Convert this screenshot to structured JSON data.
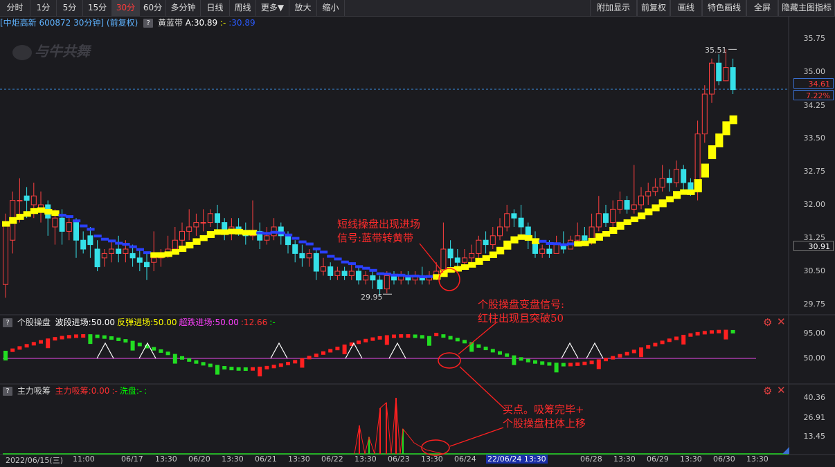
{
  "toolbar": {
    "left": [
      "分时",
      "1分",
      "5分",
      "15分",
      "30分",
      "60分",
      "多分钟",
      "日线",
      "周线",
      "更多▼",
      "放大",
      "缩小"
    ],
    "active_index": 4,
    "right": [
      "附加显示",
      "前复权",
      "画线",
      "特色画线",
      "全屏",
      "隐藏主图指标"
    ]
  },
  "info": {
    "stock": "[中炬高新 600872 30分钟]",
    "adj": "(前复权)",
    "indicator": "黄蓝带",
    "a_value": "A:30.89",
    "sep": ":-",
    "b_value": ":30.89"
  },
  "watermark": "与牛共舞",
  "main_axis": {
    "labels": [
      "35.75",
      "35.00",
      "34.25",
      "33.50",
      "32.75",
      "32.00",
      "31.25",
      "30.50",
      "29.75"
    ],
    "current_price": "34.61",
    "current_pct": "7.22%",
    "cross_price": "30.91",
    "high_label": "35.51",
    "low_label": "29.95"
  },
  "sub1": {
    "title": "个股操盘",
    "items": [
      {
        "text": "波段进场:50.00",
        "color": "#ffffff"
      },
      {
        "text": "反弹进场:50.00",
        "color": "#ffff00"
      },
      {
        "text": "超跌进场:50.00",
        "color": "#ff40ff"
      },
      {
        "text": ":12.66",
        "color": "#ff3030"
      },
      {
        "text": ":-",
        "color": "#00ff00"
      }
    ],
    "axis": [
      "95.00",
      "50.00"
    ]
  },
  "sub2": {
    "title": "主力吸筹",
    "items": [
      {
        "text": "主力吸筹:0.00",
        "color": "#ff3030"
      },
      {
        "text": ":-",
        "color": "#ff3030"
      },
      {
        "text": "洗盘:-",
        "color": "#00ff00"
      },
      {
        "text": ":",
        "color": "#00ff00"
      }
    ],
    "axis": [
      "40.36",
      "26.91",
      "13.45"
    ]
  },
  "annotations": {
    "a1_line1": "短线操盘出现进场",
    "a1_line2": "信号:蓝带转黄带",
    "a2_line1": "个股操盘变盘信号:",
    "a2_line2": "红柱出现且突破50",
    "a3_line1": "买点。吸筹完毕+",
    "a3_line2": "个股操盘柱体上移"
  },
  "xaxis": [
    {
      "text": "2022/06/15(三)",
      "x": 8
    },
    {
      "text": "11:00",
      "x": 105
    },
    {
      "text": "06/17",
      "x": 175
    },
    {
      "text": "13:30",
      "x": 224
    },
    {
      "text": "06/20",
      "x": 272
    },
    {
      "text": "13:30",
      "x": 320
    },
    {
      "text": "06/21",
      "x": 368
    },
    {
      "text": "13:30",
      "x": 416
    },
    {
      "text": "06/22",
      "x": 464
    },
    {
      "text": "13:30",
      "x": 512
    },
    {
      "text": "06/23",
      "x": 560
    },
    {
      "text": "13:30",
      "x": 608
    },
    {
      "text": "06/24",
      "x": 656
    },
    {
      "text": "22/06/24 13:30",
      "x": 702,
      "highlight": true
    },
    {
      "text": "06/28",
      "x": 838
    },
    {
      "text": "13:30",
      "x": 886
    },
    {
      "text": "06/29",
      "x": 934
    },
    {
      "text": "13:30",
      "x": 982
    },
    {
      "text": "06/30",
      "x": 1030
    },
    {
      "text": "13:30",
      "x": 1078
    }
  ],
  "chart_data": {
    "type": "candlestick",
    "interval": "30分钟",
    "ylim": [
      29.5,
      36.1
    ],
    "candles": [
      [
        30.2,
        31.6,
        31.8,
        29.9
      ],
      [
        31.2,
        32.1,
        32.3,
        30.9
      ],
      [
        32.1,
        32.1,
        32.6,
        31.6
      ],
      [
        32.2,
        32.1,
        32.4,
        31.7
      ],
      [
        32.0,
        32.2,
        32.5,
        31.7
      ],
      [
        31.9,
        32.0,
        32.3,
        31.6
      ],
      [
        32.0,
        31.7,
        32.1,
        31.3
      ],
      [
        31.5,
        31.7,
        31.9,
        31.1
      ],
      [
        31.7,
        31.4,
        31.9,
        31.1
      ],
      [
        31.4,
        31.6,
        31.7,
        31.2
      ],
      [
        31.6,
        31.2,
        31.7,
        30.8
      ],
      [
        31.2,
        31.0,
        31.4,
        30.9
      ],
      [
        31.3,
        31.1,
        31.5,
        30.8
      ],
      [
        31.0,
        30.6,
        31.2,
        30.5
      ],
      [
        30.8,
        30.9,
        31.0,
        30.6
      ],
      [
        30.9,
        31.0,
        31.2,
        30.7
      ],
      [
        31.0,
        30.9,
        31.3,
        30.7
      ],
      [
        30.9,
        31.0,
        31.2,
        30.7
      ],
      [
        30.9,
        30.8,
        31.1,
        30.6
      ],
      [
        30.8,
        30.7,
        31.0,
        30.5
      ],
      [
        30.7,
        30.6,
        30.9,
        30.3
      ],
      [
        30.7,
        30.8,
        31.4,
        30.5
      ],
      [
        30.8,
        30.9,
        31.0,
        30.6
      ],
      [
        30.9,
        31.0,
        31.3,
        30.8
      ],
      [
        31.0,
        31.2,
        31.5,
        30.9
      ],
      [
        31.2,
        31.4,
        31.6,
        31.0
      ],
      [
        31.4,
        31.5,
        31.9,
        31.2
      ],
      [
        31.5,
        31.6,
        31.8,
        31.3
      ],
      [
        31.6,
        31.6,
        31.9,
        31.4
      ],
      [
        31.6,
        31.8,
        31.9,
        31.5
      ],
      [
        31.8,
        31.6,
        32.0,
        31.4
      ],
      [
        31.6,
        31.4,
        31.7,
        31.2
      ],
      [
        31.4,
        31.5,
        31.7,
        31.2
      ],
      [
        31.5,
        31.4,
        31.7,
        31.3
      ],
      [
        31.4,
        31.3,
        31.6,
        31.1
      ],
      [
        31.3,
        31.4,
        32.1,
        31.2
      ],
      [
        31.4,
        31.2,
        31.6,
        31.0
      ],
      [
        31.2,
        31.3,
        31.5,
        31.1
      ],
      [
        31.3,
        31.5,
        31.7,
        31.2
      ],
      [
        31.5,
        31.3,
        31.6,
        31.1
      ],
      [
        31.3,
        31.1,
        31.4,
        30.9
      ],
      [
        31.1,
        30.9,
        31.2,
        30.7
      ],
      [
        30.9,
        30.8,
        31.1,
        30.6
      ],
      [
        30.8,
        30.9,
        31.0,
        30.6
      ],
      [
        30.9,
        30.5,
        31.0,
        30.3
      ],
      [
        30.5,
        30.6,
        30.8,
        30.4
      ],
      [
        30.6,
        30.4,
        30.7,
        30.3
      ],
      [
        30.4,
        30.5,
        30.6,
        30.3
      ],
      [
        30.5,
        30.4,
        30.6,
        30.3
      ],
      [
        30.4,
        30.5,
        30.7,
        30.3
      ],
      [
        30.5,
        30.3,
        30.6,
        30.2
      ],
      [
        30.3,
        30.4,
        30.5,
        30.2
      ],
      [
        30.4,
        30.3,
        30.5,
        30.1
      ],
      [
        30.3,
        30.1,
        30.4,
        29.95
      ],
      [
        30.1,
        30.4,
        30.5,
        30.0
      ],
      [
        30.4,
        30.3,
        30.5,
        30.2
      ],
      [
        30.3,
        30.4,
        30.5,
        30.2
      ],
      [
        30.4,
        30.3,
        30.5,
        30.2
      ],
      [
        30.3,
        30.4,
        30.5,
        30.2
      ],
      [
        30.4,
        30.3,
        30.6,
        30.2
      ],
      [
        30.3,
        30.4,
        30.5,
        30.2
      ],
      [
        30.4,
        30.5,
        30.7,
        30.3
      ],
      [
        30.5,
        31.0,
        31.6,
        30.4
      ],
      [
        31.0,
        30.8,
        31.2,
        30.6
      ],
      [
        30.8,
        30.7,
        31.0,
        30.6
      ],
      [
        30.7,
        30.8,
        31.0,
        30.6
      ],
      [
        30.8,
        30.9,
        31.1,
        30.7
      ],
      [
        30.9,
        31.2,
        31.3,
        30.8
      ],
      [
        31.2,
        31.1,
        31.4,
        30.9
      ],
      [
        31.1,
        31.3,
        31.5,
        31.0
      ],
      [
        31.3,
        31.5,
        31.7,
        31.2
      ],
      [
        31.5,
        31.8,
        32.0,
        31.4
      ],
      [
        31.8,
        31.7,
        31.9,
        31.5
      ],
      [
        31.7,
        31.5,
        32.0,
        31.3
      ],
      [
        31.5,
        31.2,
        31.6,
        31.0
      ],
      [
        31.2,
        30.9,
        31.4,
        30.8
      ],
      [
        30.9,
        31.0,
        31.1,
        30.8
      ],
      [
        31.0,
        30.9,
        31.2,
        30.8
      ],
      [
        30.9,
        31.1,
        31.3,
        30.9
      ],
      [
        31.1,
        31.0,
        31.4,
        30.9
      ],
      [
        31.0,
        31.2,
        31.3,
        31.0
      ],
      [
        31.2,
        31.3,
        31.6,
        31.1
      ],
      [
        31.3,
        31.2,
        31.5,
        31.1
      ],
      [
        31.2,
        31.5,
        31.8,
        31.1
      ],
      [
        31.5,
        31.8,
        32.2,
        31.4
      ],
      [
        31.8,
        31.6,
        32.0,
        31.5
      ],
      [
        31.6,
        31.9,
        32.1,
        31.5
      ],
      [
        31.9,
        32.1,
        32.3,
        31.8
      ],
      [
        32.1,
        31.9,
        32.2,
        31.8
      ],
      [
        31.9,
        32.0,
        32.9,
        31.8
      ],
      [
        32.0,
        32.2,
        32.4,
        31.9
      ],
      [
        32.2,
        32.3,
        32.5,
        32.0
      ],
      [
        32.3,
        32.4,
        32.6,
        32.2
      ],
      [
        32.4,
        32.6,
        32.9,
        32.3
      ],
      [
        32.6,
        32.5,
        32.8,
        32.3
      ],
      [
        32.5,
        32.8,
        33.0,
        32.4
      ],
      [
        32.8,
        32.5,
        32.9,
        32.3
      ],
      [
        32.5,
        32.3,
        32.6,
        32.2
      ],
      [
        32.3,
        33.6,
        33.9,
        32.1
      ],
      [
        33.6,
        34.5,
        34.7,
        33.4
      ],
      [
        34.5,
        35.2,
        35.3,
        34.3
      ],
      [
        35.2,
        34.8,
        35.4,
        34.7
      ],
      [
        34.8,
        35.1,
        35.51,
        34.9
      ],
      [
        35.1,
        34.6,
        35.3,
        34.5
      ]
    ]
  }
}
